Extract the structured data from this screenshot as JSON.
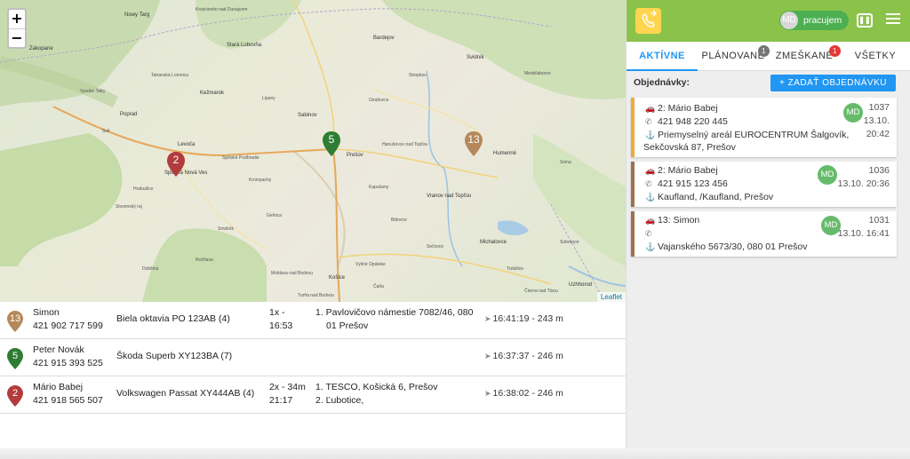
{
  "map": {
    "zoom_in": "+",
    "zoom_out": "−",
    "attribution": "Leaflet",
    "places": [
      {
        "name": "Zakopane"
      },
      {
        "name": "Nowy Targ"
      },
      {
        "name": "Krościenko nad Dunajcem"
      },
      {
        "name": "Stará Ľubovňa"
      },
      {
        "name": "Bardejov"
      },
      {
        "name": "Svidník"
      },
      {
        "name": "Kežmarok"
      },
      {
        "name": "Poprad"
      },
      {
        "name": "Levoča"
      },
      {
        "name": "Spišská Nová Ves"
      },
      {
        "name": "Sabinov"
      },
      {
        "name": "Prešov"
      },
      {
        "name": "Vranov nad Topľou"
      },
      {
        "name": "Humenné"
      },
      {
        "name": "Košice"
      },
      {
        "name": "Michalovce"
      },
      {
        "name": "Gelnica"
      },
      {
        "name": "Rožňava"
      },
      {
        "name": "Stropkov"
      },
      {
        "name": "Medzilaborce"
      },
      {
        "name": "Snina"
      },
      {
        "name": "Hanušovce nad Topľou"
      },
      {
        "name": "Giraltovce"
      },
      {
        "name": "Lipany"
      },
      {
        "name": "Sečovce"
      },
      {
        "name": "Trebišov"
      },
      {
        "name": "Moldava nad Bodvou"
      },
      {
        "name": "Čierna nad Tisou"
      },
      {
        "name": "Sobrance"
      },
      {
        "name": "Uzhhorod"
      },
      {
        "name": "Dobšiná"
      },
      {
        "name": "Spišské Podhradie"
      },
      {
        "name": "Krompachy"
      },
      {
        "name": "Vysoké Tatry"
      },
      {
        "name": "Tatranská Lomnica"
      },
      {
        "name": "Svit"
      },
      {
        "name": "Hrabušice"
      },
      {
        "name": "Slovenský raj"
      },
      {
        "name": "Smolník"
      },
      {
        "name": "Vyšné Opátske"
      },
      {
        "name": "Kapušany"
      },
      {
        "name": "Čaňa"
      },
      {
        "name": "Turňa nad Bodvou"
      },
      {
        "name": "Bidovce"
      }
    ],
    "markers": [
      {
        "label": "5",
        "color": "#2e7d32"
      },
      {
        "label": "13",
        "color": "#b5875a"
      },
      {
        "label": "2",
        "color": "#b23b3b"
      }
    ]
  },
  "vehicles": [
    {
      "pin": "13",
      "pin_color": "#b5875a",
      "name": "Simon",
      "phone": "421 902 717 599",
      "car": "Biela oktavia PO 123AB (4)",
      "count": "1x -",
      "time": "16:53",
      "addr1": "1. Pavlovičovo námestie 7082/46, 080",
      "addr2": "01 Prešov",
      "last_seen": "16:41:19 - 243 m"
    },
    {
      "pin": "5",
      "pin_color": "#2e7d32",
      "name": "Peter Novák",
      "phone": "421 915 393 525",
      "car": "Škoda Superb XY123BA (7)",
      "count": "",
      "time": "",
      "addr1": "",
      "addr2": "",
      "last_seen": "16:37:37 - 246 m"
    },
    {
      "pin": "2",
      "pin_color": "#b23b3b",
      "name": "Mário Babej",
      "phone": "421 918 565 507",
      "car": "Volkswagen Passat XY444AB (4)",
      "count": "2x - 34m",
      "time": "21:17",
      "addr1": "1. TESCO, Košická 6, Prešov",
      "addr2": "2. Ľubotice,",
      "last_seen": "16:38:02 - 246 m"
    }
  ],
  "panel": {
    "logo_icon": "phone-icon",
    "user_initials": "MD",
    "status_label": "pracujem",
    "status_color": "#4caf50",
    "accent_color": "#8bc34a",
    "tabs": [
      {
        "label": "AKTÍVNE",
        "active": true,
        "badge": ""
      },
      {
        "label": "PLÁNOVANÉ",
        "active": false,
        "badge": "1"
      },
      {
        "label": "ZMEŠKANÉ",
        "active": false,
        "badge": "1"
      },
      {
        "label": "VŠETKY",
        "active": false,
        "badge": ""
      }
    ],
    "orders_title": "Objednávky:",
    "add_order_label": "+ ZADAŤ OBJEDNÁVKU",
    "orders": [
      {
        "customer": "2: Mário Babej",
        "phone": "421 948 220 445",
        "address_1": "Priemyselný areál EUROCENTRUM Šalgovík,",
        "address_2": "Sekčovská 87, Prešov",
        "driver": "MD",
        "id": "1037",
        "date": "13.10.",
        "time": "20:42",
        "stripe": "#f0a93c"
      },
      {
        "customer": "2: Mário Babej",
        "phone": "421 915 123 456",
        "address_1": "Kaufland, /Kaufland, Prešov",
        "address_2": "",
        "driver": "MD",
        "id": "1036",
        "date": "13.10. 20:36",
        "time": "",
        "stripe": "#a0724a"
      },
      {
        "customer": "13: Simon",
        "phone": "",
        "address_1": "Vajanského 5673/30, 080 01 Prešov",
        "address_2": "",
        "driver": "MD",
        "id": "1031",
        "date": "13.10. 16:41",
        "time": "",
        "stripe": "#a0724a"
      }
    ]
  }
}
